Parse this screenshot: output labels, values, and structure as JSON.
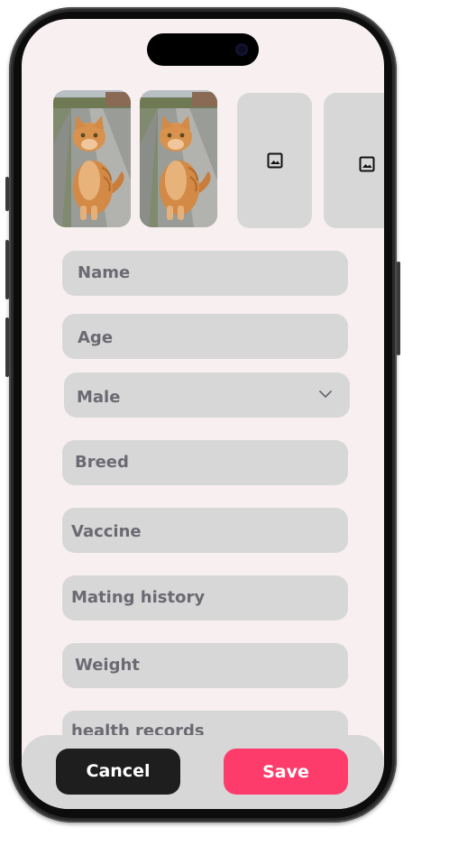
{
  "photos": {
    "filled": [
      {
        "description_icon": "cat-photo"
      },
      {
        "description_icon": "cat-photo"
      }
    ],
    "empty_slots": [
      {
        "icon": "image-icon"
      },
      {
        "icon": "image-icon"
      }
    ]
  },
  "form": {
    "name_placeholder": "Name",
    "age_placeholder": "Age",
    "gender_selected": "Male",
    "breed_placeholder": "Breed",
    "vaccine_placeholder": "Vaccine",
    "mating_history_placeholder": "Mating history",
    "weight_placeholder": "Weight",
    "health_records_placeholder": "health records"
  },
  "actions": {
    "cancel_label": "Cancel",
    "save_label": "Save"
  },
  "colors": {
    "screen_background": "#f7eff0",
    "field_background": "#d7d7d7",
    "placeholder_text": "#6a6a72",
    "cancel_button": "#1e1e1e",
    "save_button": "#fe3c6b"
  }
}
